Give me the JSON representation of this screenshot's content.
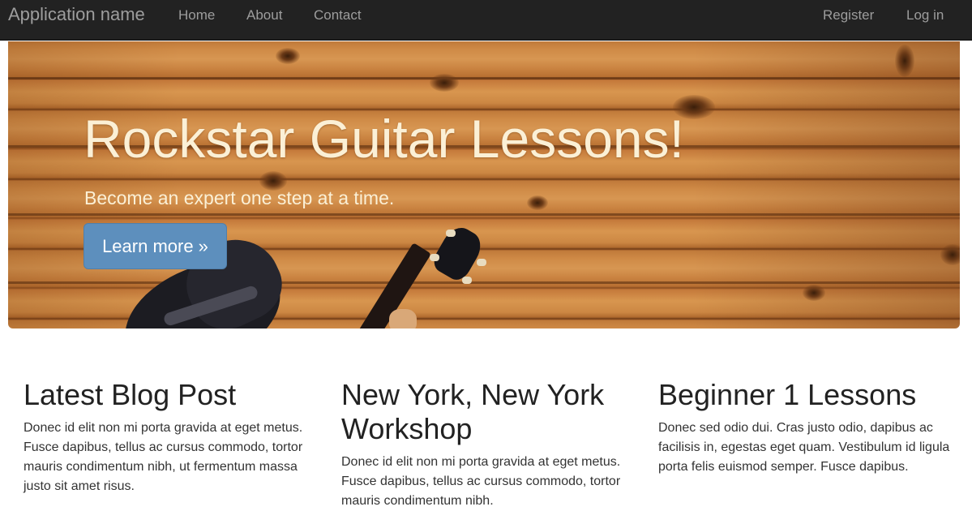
{
  "navbar": {
    "brand": "Application name",
    "links": [
      "Home",
      "About",
      "Contact"
    ],
    "register": "Register",
    "login": "Log in"
  },
  "hero": {
    "title": "Rockstar Guitar Lessons!",
    "subtitle": "Become an expert one step at a time.",
    "button_label": "Learn more »"
  },
  "columns": [
    {
      "heading": "Latest Blog Post",
      "text": "Donec id elit non mi porta gravida at eget metus. Fusce dapibus, tellus ac cursus commodo, tortor mauris condimentum nibh, ut fermentum massa justo sit amet risus."
    },
    {
      "heading": "New York, New York Workshop",
      "text": "Donec id elit non mi porta gravida at eget metus. Fusce dapibus, tellus ac cursus commodo, tortor mauris condimentum nibh."
    },
    {
      "heading": "Beginner 1 Lessons",
      "text": "Donec sed odio dui. Cras justo odio, dapibus ac facilisis in, egestas eget quam. Vestibulum id ligula porta felis euismod semper. Fusce dapibus."
    }
  ],
  "colors": {
    "navbar_bg": "#222222",
    "nav_text": "#9d9d9d",
    "hero_text": "#fbf0d6",
    "button_bg": "#5d8fbd",
    "wood": "#cf8a46"
  }
}
